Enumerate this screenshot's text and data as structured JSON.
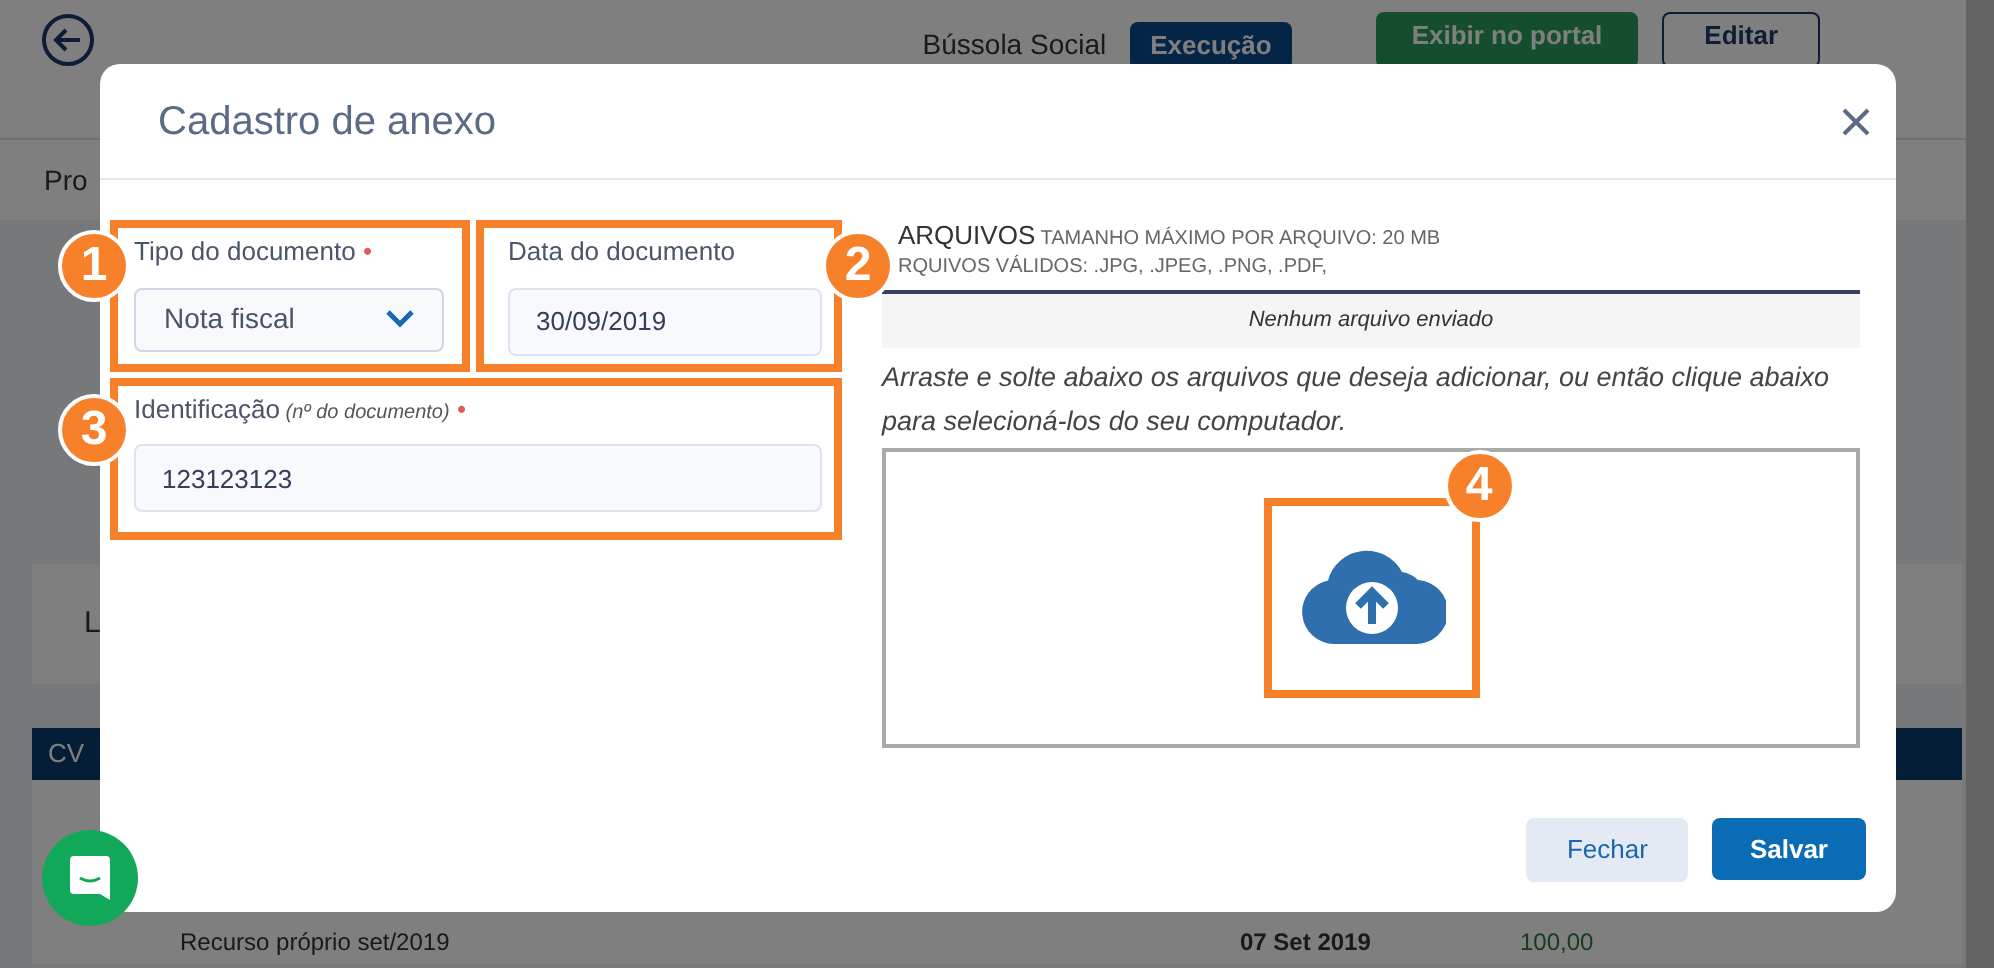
{
  "background_page": {
    "header": {
      "section": "Bússola Social",
      "status_badge": "Execução",
      "portal_button": "Exibir no portal",
      "edit_button": "Editar"
    },
    "tab": "Pro",
    "card_label": "L",
    "table": {
      "columns": [
        "CV"
      ],
      "rows": [
        {
          "description": "Recurso próprio set/2019",
          "date": "07 Set 2019",
          "value": "100,00"
        }
      ]
    }
  },
  "modal": {
    "title": "Cadastro de anexo",
    "fields": [
      {
        "kind": "select",
        "label": "Tipo do documento",
        "required_mark": "•",
        "value": "Nota fiscal",
        "callout": "1"
      },
      {
        "kind": "text",
        "label": "Data do documento",
        "value": "30/09/2019",
        "callout": "2"
      },
      {
        "kind": "text",
        "label": "Identificação",
        "hint": "(nº do documento)",
        "required_mark": "•",
        "value": "123123123",
        "callout": "3"
      }
    ],
    "files": {
      "title": "ARQUIVOS",
      "max_size": "TAMANHO MÁXIMO POR ARQUIVO: 20 MB",
      "valid_types": "RQUIVOS VÁLIDOS: .JPG, .JPEG, .PNG, .PDF,",
      "empty_state": "Nenhum arquivo enviado",
      "instructions": "Arraste e solte abaixo os arquivos que deseja adicionar, ou então clique abaixo para selecioná-los do seu computador.",
      "upload_callout": "4"
    },
    "buttons": [
      {
        "kind": "secondary",
        "label": "Fechar"
      },
      {
        "kind": "primary",
        "label": "Salvar"
      }
    ]
  }
}
